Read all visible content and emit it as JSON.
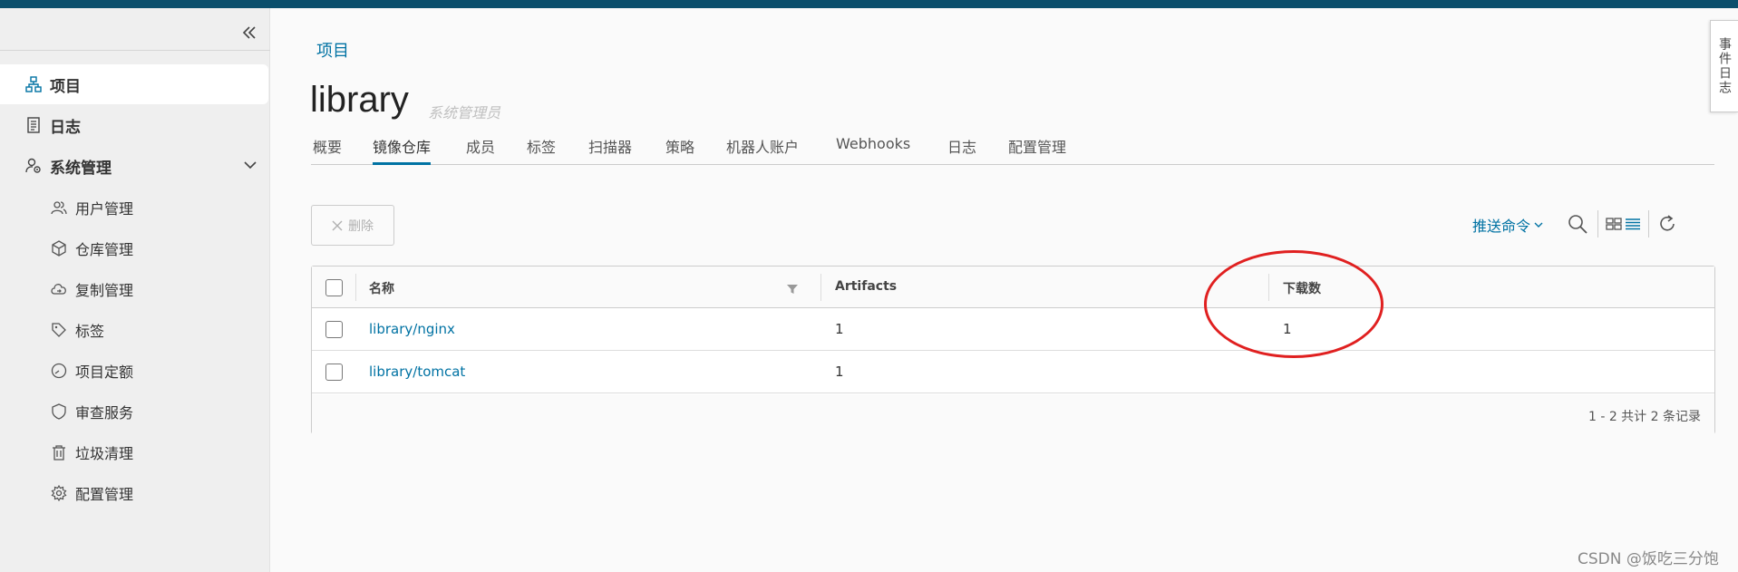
{
  "sidebar": {
    "items": [
      {
        "label": "项目",
        "icon": "project-icon"
      },
      {
        "label": "日志",
        "icon": "log-icon"
      },
      {
        "label": "系统管理",
        "icon": "admin-icon"
      }
    ],
    "sub_items": [
      {
        "label": "用户管理",
        "icon": "users-icon"
      },
      {
        "label": "仓库管理",
        "icon": "registry-icon"
      },
      {
        "label": "复制管理",
        "icon": "replication-icon"
      },
      {
        "label": "标签",
        "icon": "tag-icon"
      },
      {
        "label": "项目定额",
        "icon": "quota-icon"
      },
      {
        "label": "审查服务",
        "icon": "shield-icon"
      },
      {
        "label": "垃圾清理",
        "icon": "trash-icon"
      },
      {
        "label": "配置管理",
        "icon": "gear-icon"
      }
    ]
  },
  "event_tab": "事件日志",
  "breadcrumb": "项目",
  "page": {
    "title": "library",
    "role": "系统管理员"
  },
  "tabs": [
    "概要",
    "镜像仓库",
    "成员",
    "标签",
    "扫描器",
    "策略",
    "机器人账户",
    "Webhooks",
    "日志",
    "配置管理"
  ],
  "active_tab": "镜像仓库",
  "toolbar": {
    "delete_label": "删除",
    "push_command_label": "推送命令"
  },
  "table": {
    "columns": [
      "名称",
      "Artifacts",
      "下载数"
    ],
    "rows": [
      {
        "name": "library/nginx",
        "artifacts": "1",
        "downloads": "1"
      },
      {
        "name": "library/tomcat",
        "artifacts": "1",
        "downloads": ""
      }
    ],
    "footer": "1 - 2 共计 2 条记录"
  },
  "watermark": "CSDN @饭吃三分饱",
  "colors": {
    "accent": "#0072a3",
    "topbar": "#0b4f6c",
    "annotation": "#e02020"
  }
}
